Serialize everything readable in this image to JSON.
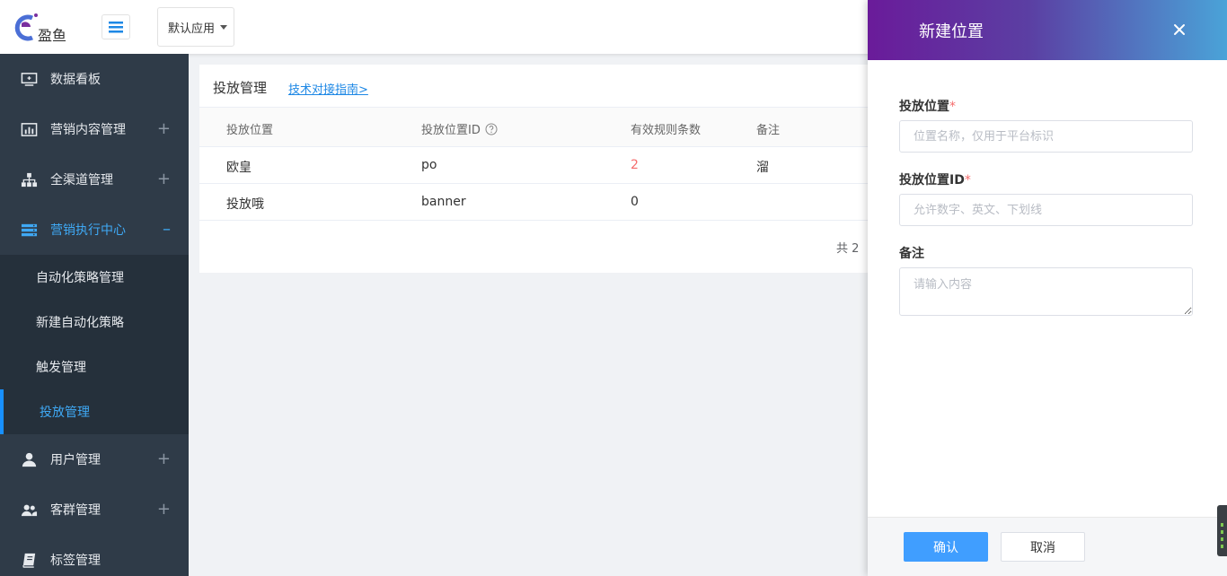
{
  "header": {
    "logo_text": "盈鱼",
    "app_select": "默认应用"
  },
  "sidebar": {
    "items": [
      {
        "label": "数据看板",
        "toggle": ""
      },
      {
        "label": "营销内容管理",
        "toggle": "+"
      },
      {
        "label": "全渠道管理",
        "toggle": "+"
      },
      {
        "label": "营销执行中心",
        "toggle": "–"
      },
      {
        "label": "用户管理",
        "toggle": "+"
      },
      {
        "label": "客群管理",
        "toggle": "+"
      },
      {
        "label": "标签管理",
        "toggle": ""
      }
    ],
    "sub_items": [
      {
        "label": "自动化策略管理"
      },
      {
        "label": "新建自动化策略"
      },
      {
        "label": "触发管理"
      },
      {
        "label": "投放管理"
      }
    ]
  },
  "main": {
    "title": "投放管理",
    "link": "技术对接指南>",
    "columns": [
      "投放位置",
      "投放位置ID",
      "有效规则条数",
      "备注"
    ],
    "rows": [
      {
        "name": "欧皇",
        "id": "po",
        "count": "2",
        "note": "溜"
      },
      {
        "name": "投放哦",
        "id": "banner",
        "count": "0",
        "note": ""
      }
    ],
    "pager_text": "共 2"
  },
  "drawer": {
    "title": "新建位置",
    "field1": {
      "label": "投放位置",
      "placeholder": "位置名称，仅用于平台标识"
    },
    "field2": {
      "label": "投放位置ID",
      "placeholder": "允许数字、英文、下划线"
    },
    "field3": {
      "label": "备注",
      "placeholder": "请输入内容"
    },
    "confirm": "确认",
    "cancel": "取消",
    "required_mark": "*"
  },
  "colors": {
    "sidebar_bg": "#2f3b48",
    "accent": "#409eff",
    "active_text": "#3fa9f5",
    "danger": "#f56c6c"
  }
}
